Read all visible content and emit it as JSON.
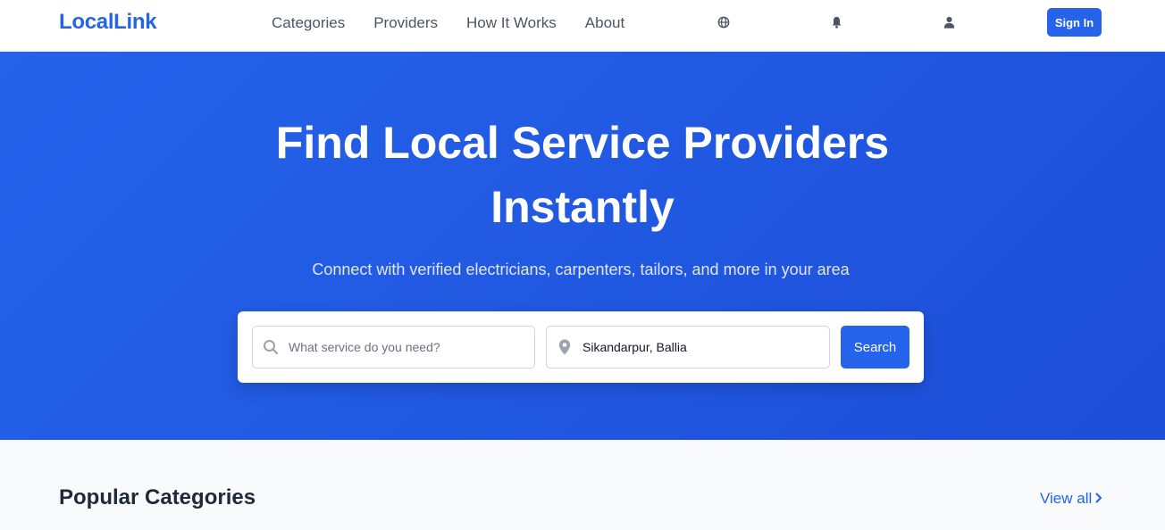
{
  "brand": {
    "name": "LocalLink",
    "accent": "#2563eb"
  },
  "nav": {
    "items": [
      {
        "label": "Categories"
      },
      {
        "label": "Providers"
      },
      {
        "label": "How It Works"
      },
      {
        "label": "About"
      }
    ],
    "icons": [
      "globe-icon",
      "bell-icon",
      "user-icon"
    ],
    "sign_in": "Sign In"
  },
  "hero": {
    "title": "Find Local Service Providers Instantly",
    "subtitle": "Connect with verified electricians, carpenters, tailors, and more in your area",
    "search": {
      "service_placeholder": "What service do you need?",
      "service_value": "",
      "location_value": "Sikandarpur, Ballia",
      "button": "Search"
    }
  },
  "popular": {
    "title": "Popular Categories",
    "view_all": "View all"
  }
}
